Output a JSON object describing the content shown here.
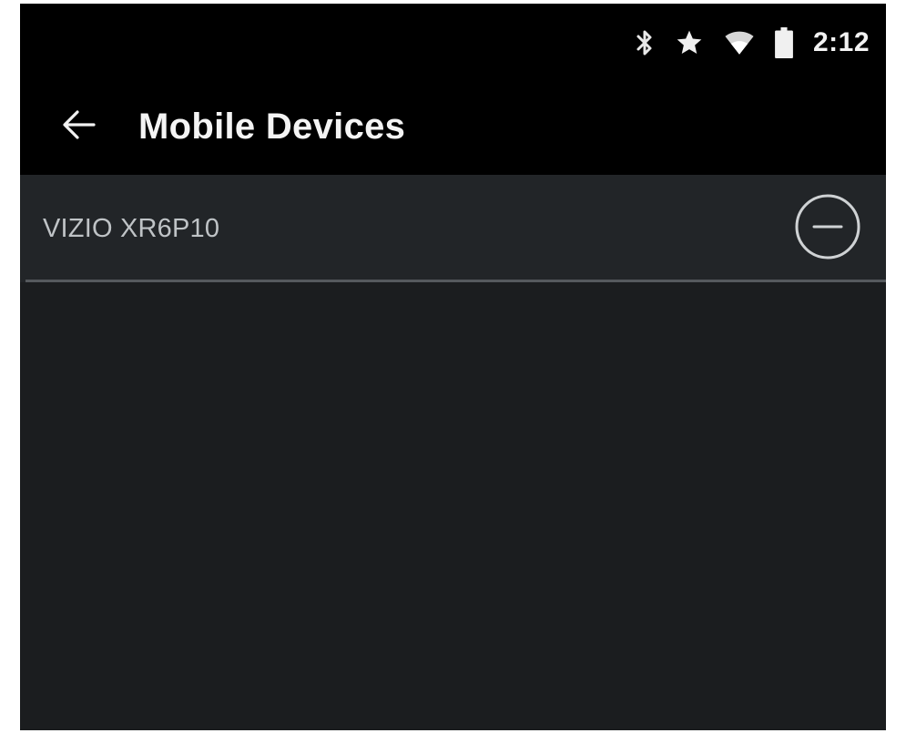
{
  "status_bar": {
    "time": "2:12",
    "icons": [
      "bluetooth-icon",
      "star-icon",
      "wifi-icon",
      "battery-icon"
    ]
  },
  "app_bar": {
    "title": "Mobile Devices",
    "back_icon": "arrow-back-icon"
  },
  "device_list": {
    "items": [
      {
        "label": "VIZIO XR6P10",
        "action_icon": "remove-circle-icon"
      }
    ]
  },
  "colors": {
    "status_bar_bg": "#000000",
    "app_bar_bg": "#000000",
    "screen_bg": "#1b1d1f",
    "list_item_bg": "#222528",
    "title_text": "#f4f4f4",
    "item_text": "#bfc3c6",
    "divider": "#55595d"
  }
}
